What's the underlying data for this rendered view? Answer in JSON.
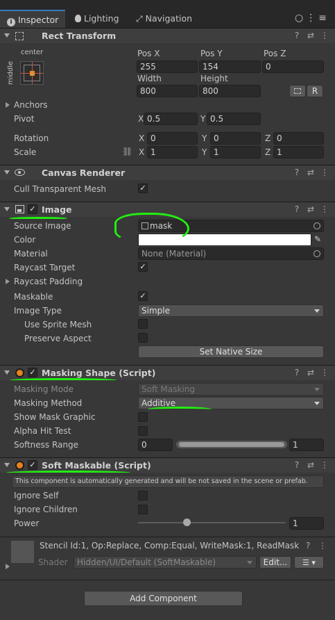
{
  "tabs": [
    {
      "label": "Inspector",
      "icon": "info-icon"
    },
    {
      "label": "Lighting",
      "icon": "bulb-icon"
    },
    {
      "label": "Navigation",
      "icon": "navigation-icon"
    }
  ],
  "rect_transform": {
    "title": "Rect Transform",
    "anchor_top": "center",
    "anchor_side": "middle",
    "pos_x_label": "Pos X",
    "pos_y_label": "Pos Y",
    "pos_z_label": "Pos Z",
    "pos_x": "255",
    "pos_y": "154",
    "pos_z": "0",
    "width_label": "Width",
    "height_label": "Height",
    "width": "800",
    "height": "800",
    "raw_button": "R",
    "anchors_label": "Anchors",
    "pivot_label": "Pivot",
    "pivot_x": "0.5",
    "pivot_y": "0.5",
    "rotation_label": "Rotation",
    "rot_x": "0",
    "rot_y": "0",
    "rot_z": "0",
    "scale_label": "Scale",
    "scale_x": "1",
    "scale_y": "1",
    "scale_z": "1",
    "x": "X",
    "y": "Y",
    "z": "Z"
  },
  "canvas_renderer": {
    "title": "Canvas Renderer",
    "cull_label": "Cull Transparent Mesh",
    "cull_checked": "✓"
  },
  "image": {
    "title": "Image",
    "enabled": "✓",
    "source_label": "Source Image",
    "source_value": "mask",
    "color_label": "Color",
    "material_label": "Material",
    "material_value": "None (Material)",
    "raycast_label": "Raycast Target",
    "raycast_checked": "✓",
    "raycast_padding_label": "Raycast Padding",
    "maskable_label": "Maskable",
    "maskable_checked": "✓",
    "image_type_label": "Image Type",
    "image_type_value": "Simple",
    "sprite_mesh_label": "Use Sprite Mesh",
    "preserve_label": "Preserve Aspect",
    "native_button": "Set Native Size"
  },
  "masking_shape": {
    "title": "Masking Shape (Script)",
    "enabled": "✓",
    "mode_label": "Masking Mode",
    "mode_value": "Soft Masking",
    "method_label": "Masking Method",
    "method_value": "Additive",
    "show_graphic_label": "Show Mask Graphic",
    "alpha_hit_label": "Alpha Hit Test",
    "softness_label": "Softness Range",
    "softness_min": "0",
    "softness_max": "1"
  },
  "soft_maskable": {
    "title": "Soft Maskable (Script)",
    "enabled": "✓",
    "info": "This component is automatically generated and will be not saved in the scene or prefab.",
    "ignore_self_label": "Ignore Self",
    "ignore_children_label": "Ignore Children",
    "power_label": "Power",
    "power_value": "1",
    "power_slider_fraction": 0.33
  },
  "material_preview": {
    "stencil": "Stencil Id:1, Op:Replace, Comp:Equal, WriteMask:1, ReadMask",
    "shader_label": "Shader",
    "shader_value": "Hidden/UI/Default (SoftMaskable)",
    "edit_button": "Edit..."
  },
  "add_component": "Add Component",
  "colors": {
    "accent_annotation": "#22ee11",
    "tab_highlight": "#3a79bb"
  }
}
